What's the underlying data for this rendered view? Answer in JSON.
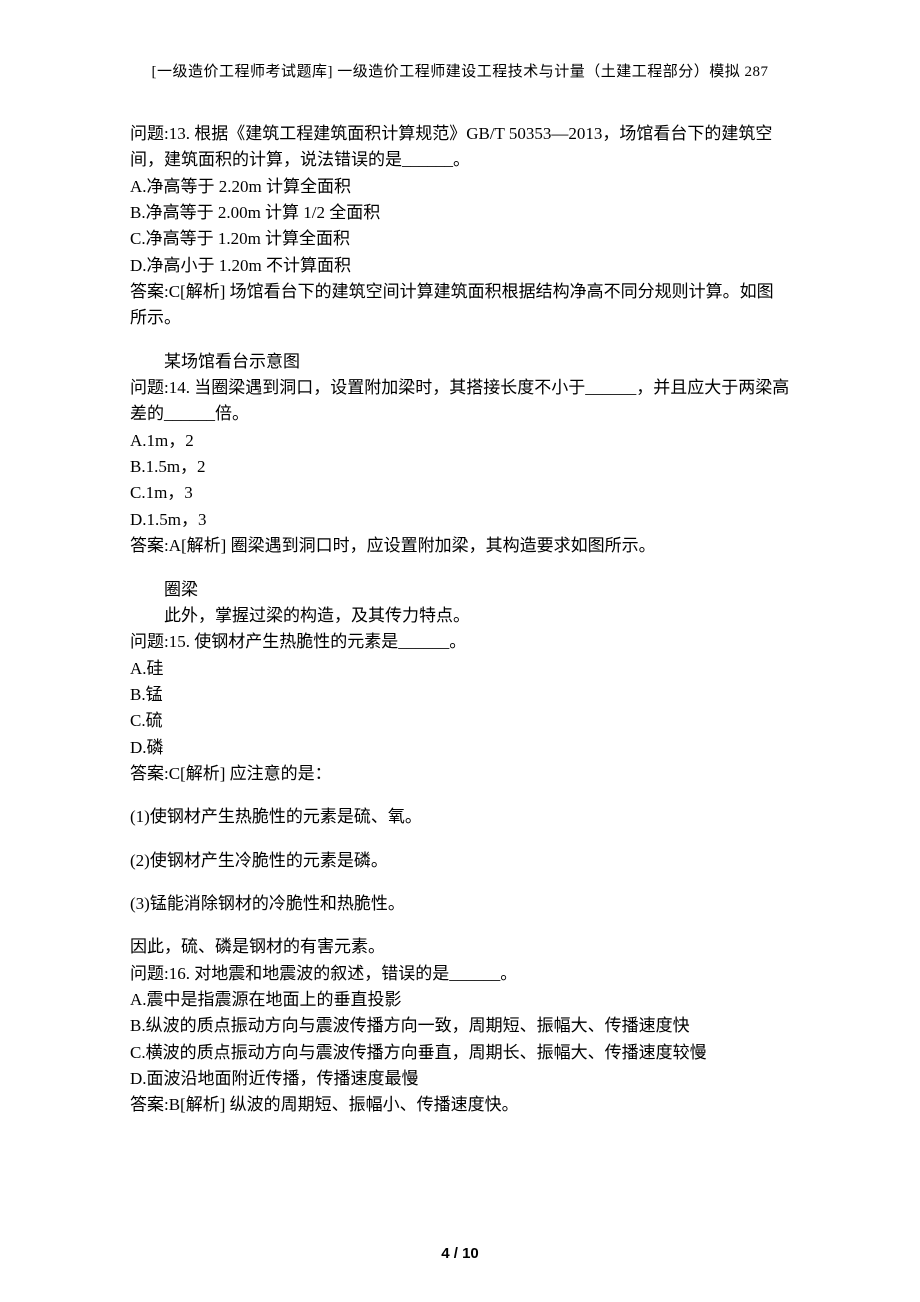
{
  "header": "[一级造价工程师考试题库] 一级造价工程师建设工程技术与计量（土建工程部分）模拟 287",
  "q13": {
    "prompt_a": "问题:13.   根据《建筑工程建筑面积计算规范》GB/T 50353—2013，场馆看台下的建筑空间，建筑面积的计算，说法错误的是",
    "prompt_b": "。",
    "opts": {
      "A": "A.净高等于 2.20m 计算全面积",
      "B": "B.净高等于 2.00m 计算 1/2 全面积",
      "C": "C.净高等于 1.20m 计算全面积",
      "D": "D.净高小于 1.20m 不计算面积"
    },
    "ans": "答案:C[解析] 场馆看台下的建筑空间计算建筑面积根据结构净高不同分规则计算。如图所示。",
    "fig": "某场馆看台示意图"
  },
  "q14": {
    "prompt_a": "问题:14.   当圈梁遇到洞口，设置附加梁时，其搭接长度不小于",
    "prompt_b": "，并且应大于两梁高差的",
    "prompt_c": "倍。",
    "opts": {
      "A": "A.1m，2",
      "B": "B.1.5m，2",
      "C": "C.1m，3",
      "D": "D.1.5m，3"
    },
    "ans": "答案:A[解析] 圈梁遇到洞口时，应设置附加梁，其构造要求如图所示。",
    "fig": "圈梁",
    "note": "此外，掌握过梁的构造，及其传力特点。"
  },
  "q15": {
    "prompt_a": "问题:15.   使钢材产生热脆性的元素是",
    "prompt_b": "。",
    "opts": {
      "A": "A.硅",
      "B": "B.锰",
      "C": "C.硫",
      "D": "D.磷"
    },
    "ans": "答案:C[解析] 应注意的是：",
    "notes": {
      "n1": "(1)使钢材产生热脆性的元素是硫、氧。",
      "n2": "(2)使钢材产生冷脆性的元素是磷。",
      "n3": "(3)锰能消除钢材的冷脆性和热脆性。",
      "n4": "因此，硫、磷是钢材的有害元素。"
    }
  },
  "q16": {
    "prompt_a": "问题:16.   对地震和地震波的叙述，错误的是",
    "prompt_b": "。",
    "opts": {
      "A": "A.震中是指震源在地面上的垂直投影",
      "B": "B.纵波的质点振动方向与震波传播方向一致，周期短、振幅大、传播速度快",
      "C": "C.横波的质点振动方向与震波传播方向垂直，周期长、振幅大、传播速度较慢",
      "D": "D.面波沿地面附近传播，传播速度最慢"
    },
    "ans": "答案:B[解析] 纵波的周期短、振幅小、传播速度快。"
  },
  "page_num": "4 / 10",
  "blank": "______"
}
